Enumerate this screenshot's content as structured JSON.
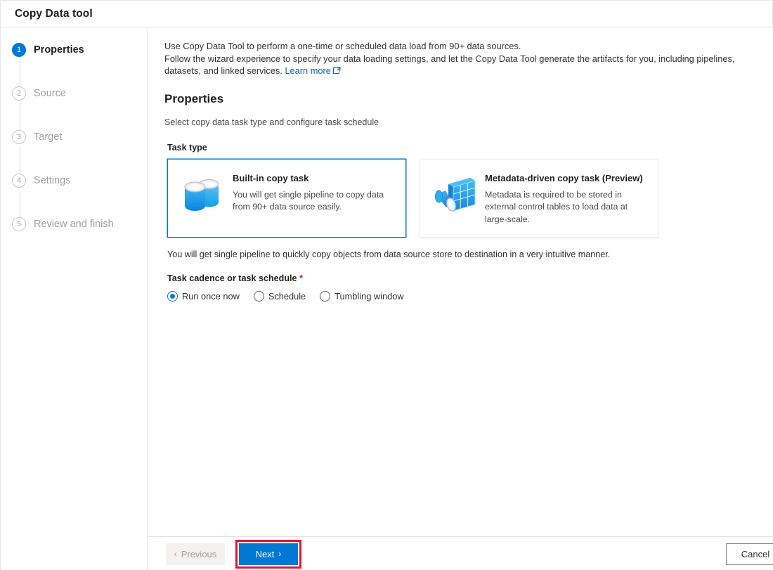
{
  "window": {
    "title": "Copy Data tool"
  },
  "sidebar": {
    "steps": [
      {
        "number": "1",
        "label": "Properties",
        "state": "active"
      },
      {
        "number": "2",
        "label": "Source",
        "state": "inactive"
      },
      {
        "number": "3",
        "label": "Target",
        "state": "inactive"
      },
      {
        "number": "4",
        "label": "Settings",
        "state": "inactive"
      },
      {
        "number": "5",
        "label": "Review and finish",
        "state": "inactive"
      }
    ]
  },
  "content": {
    "intro_line1": "Use Copy Data Tool to perform a one-time or scheduled data load from 90+ data sources.",
    "intro_line2": "Follow the wizard experience to specify your data loading settings, and let the Copy Data Tool generate the artifacts for you, including pipelines, datasets, and linked services.",
    "learn_more": "Learn more",
    "heading": "Properties",
    "subtext": "Select copy data task type and configure task schedule",
    "task_type_label": "Task type",
    "cards": [
      {
        "title": "Built-in copy task",
        "description": "You will get single pipeline to copy data from 90+ data source easily.",
        "icon": "database-copy-icon",
        "selected": true
      },
      {
        "title": "Metadata-driven copy task (Preview)",
        "description": "Metadata is required to be stored in external control tables to load data at large-scale.",
        "icon": "metadata-table-icon",
        "selected": false
      }
    ],
    "note": "You will get single pipeline to quickly copy objects from data source store to destination in a very intuitive manner.",
    "schedule_label": "Task cadence or task schedule",
    "required_mark": "*",
    "schedule_options": [
      {
        "label": "Run once now",
        "checked": true
      },
      {
        "label": "Schedule",
        "checked": false
      },
      {
        "label": "Tumbling window",
        "checked": false
      }
    ]
  },
  "footer": {
    "previous_label": "Previous",
    "next_label": "Next",
    "cancel_label": "Cancel",
    "chevron_left": "‹",
    "chevron_right": "›"
  },
  "colors": {
    "accent": "#0078d4",
    "annotation": "#e8112d",
    "link": "#0066cc"
  }
}
